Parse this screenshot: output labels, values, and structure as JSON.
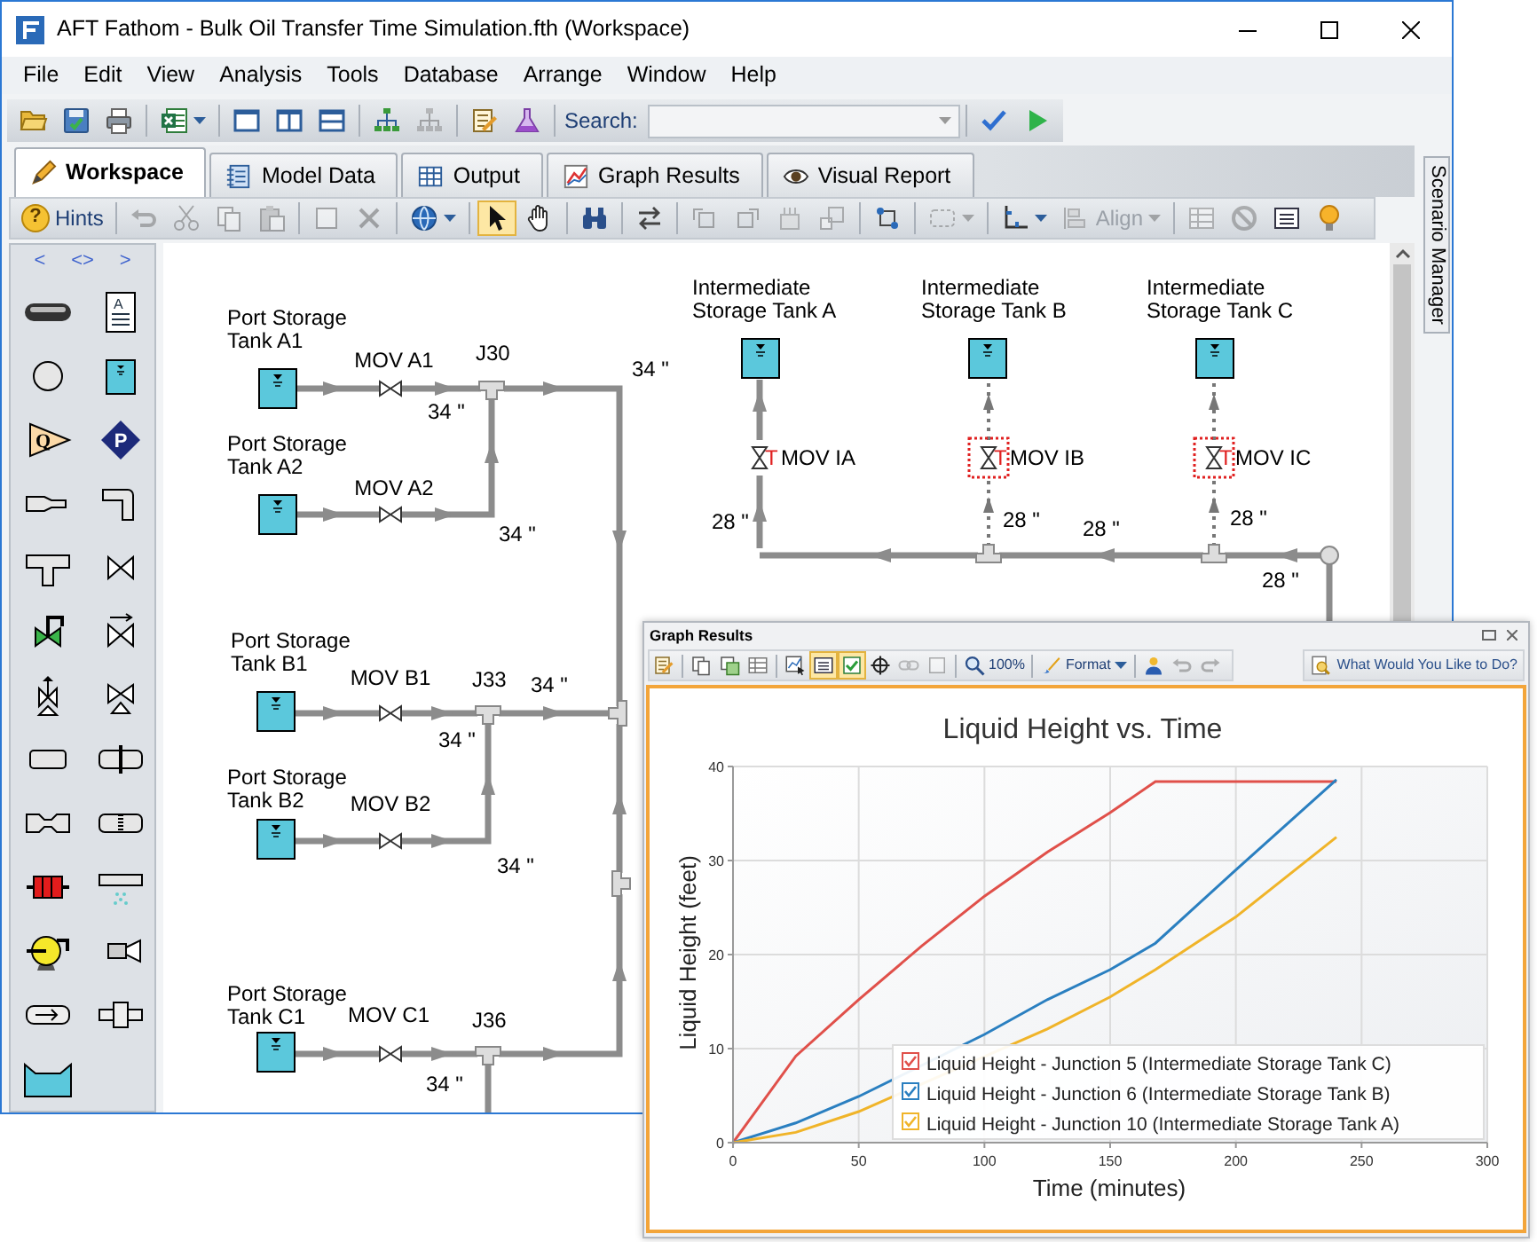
{
  "window": {
    "title": "AFT Fathom - Bulk Oil Transfer Time Simulation.fth (Workspace)"
  },
  "menu": [
    "File",
    "Edit",
    "View",
    "Analysis",
    "Tools",
    "Database",
    "Arrange",
    "Window",
    "Help"
  ],
  "toolbar": {
    "groups": [
      [
        {
          "kind": "open",
          "disabled": false,
          "selected": false,
          "dropdown": false
        },
        {
          "kind": "save",
          "disabled": false,
          "selected": false,
          "dropdown": false
        },
        {
          "kind": "print",
          "disabled": false,
          "selected": false,
          "dropdown": false
        }
      ],
      [
        {
          "kind": "export",
          "disabled": false,
          "selected": false,
          "dropdown": true
        }
      ],
      [
        {
          "kind": "pane-single",
          "disabled": false,
          "selected": false,
          "dropdown": false
        },
        {
          "kind": "pane-columns",
          "disabled": false,
          "selected": false,
          "dropdown": false
        },
        {
          "kind": "pane-rows",
          "disabled": false,
          "selected": false,
          "dropdown": false
        }
      ],
      [
        {
          "kind": "tree",
          "disabled": false,
          "selected": false,
          "dropdown": false
        },
        {
          "kind": "tree",
          "disabled": true,
          "selected": false,
          "dropdown": false
        }
      ],
      [
        {
          "kind": "edit-list",
          "disabled": false,
          "selected": false,
          "dropdown": false
        },
        {
          "kind": "flask",
          "disabled": false,
          "selected": false,
          "dropdown": false
        }
      ]
    ],
    "search": {
      "label": "Search:"
    },
    "after_groups": [
      [
        {
          "kind": "check",
          "disabled": false,
          "selected": false,
          "dropdown": false
        },
        {
          "kind": "run",
          "disabled": false,
          "selected": false,
          "dropdown": false
        }
      ]
    ]
  },
  "tabs": [
    {
      "label": "Workspace",
      "kind": "pencil",
      "selected": true
    },
    {
      "label": "Model Data",
      "kind": "notebook",
      "selected": false
    },
    {
      "label": "Output",
      "kind": "table",
      "selected": false
    },
    {
      "label": "Graph Results",
      "kind": "chart",
      "selected": false
    },
    {
      "label": "Visual Report",
      "kind": "eye",
      "selected": false
    }
  ],
  "workspace_toolbar": {
    "groups": [
      [
        {
          "kind": "hints",
          "glyph": "?",
          "label": "Hints",
          "disabled": false,
          "selected": false,
          "dropdown": false
        }
      ],
      [
        {
          "kind": "undo",
          "disabled": true,
          "selected": false,
          "dropdown": false
        },
        {
          "kind": "cut",
          "disabled": true,
          "selected": false,
          "dropdown": false
        },
        {
          "kind": "copy",
          "disabled": true,
          "selected": false,
          "dropdown": false
        },
        {
          "kind": "paste",
          "disabled": true,
          "selected": false,
          "dropdown": false
        }
      ],
      [
        {
          "kind": "square",
          "disabled": true,
          "selected": false,
          "dropdown": false
        },
        {
          "kind": "delete",
          "disabled": true,
          "selected": false,
          "dropdown": false
        }
      ],
      [
        {
          "kind": "globe",
          "disabled": false,
          "selected": false,
          "dropdown": true
        }
      ],
      [
        {
          "kind": "pointer",
          "disabled": false,
          "selected": true,
          "dropdown": false
        },
        {
          "kind": "hand",
          "disabled": false,
          "selected": false,
          "dropdown": false
        }
      ],
      [
        {
          "kind": "binoculars",
          "disabled": false,
          "selected": false,
          "dropdown": false
        }
      ],
      [
        {
          "kind": "swap",
          "disabled": false,
          "selected": false,
          "dropdown": false
        }
      ],
      [
        {
          "kind": "rotate-left",
          "disabled": true,
          "selected": false,
          "dropdown": false
        },
        {
          "kind": "rotate-right",
          "disabled": true,
          "selected": false,
          "dropdown": false
        },
        {
          "kind": "stack",
          "disabled": true,
          "selected": false,
          "dropdown": false
        },
        {
          "kind": "resize",
          "disabled": true,
          "selected": false,
          "dropdown": false
        }
      ],
      [
        {
          "kind": "nodes",
          "disabled": false,
          "selected": false,
          "dropdown": false
        }
      ],
      [
        {
          "kind": "dashed-select",
          "disabled": true,
          "selected": false,
          "dropdown": true
        }
      ],
      [
        {
          "kind": "axes",
          "disabled": false,
          "selected": false,
          "dropdown": true
        },
        {
          "kind": "align",
          "label": "Align",
          "disabled": true,
          "selected": false,
          "dropdown": true
        }
      ],
      [
        {
          "kind": "grid",
          "disabled": true,
          "selected": false,
          "dropdown": false
        },
        {
          "kind": "no-entry",
          "disabled": true,
          "selected": false,
          "dropdown": false
        },
        {
          "kind": "list-panel",
          "disabled": false,
          "selected": false,
          "dropdown": false
        },
        {
          "kind": "bulb",
          "disabled": false,
          "selected": false,
          "dropdown": false
        }
      ]
    ]
  },
  "palette": {
    "nav": [
      "<",
      "<>",
      ">"
    ],
    "annotation_letter": "A",
    "flow_letter": "Q",
    "pressure_letter": "P"
  },
  "diagram": {
    "tanks": [
      {
        "label": "Port Storage\nTank A1"
      },
      {
        "label": "Port Storage\nTank A2"
      },
      {
        "label": "Port Storage\nTank B1"
      },
      {
        "label": "Port Storage\nTank B2"
      },
      {
        "label": "Port Storage\nTank C1"
      },
      {
        "label": "Intermediate\nStorage Tank A"
      },
      {
        "label": "Intermediate\nStorage Tank B"
      },
      {
        "label": "Intermediate\nStorage Tank C"
      }
    ],
    "valves": [
      {
        "label": "MOV A1",
        "highlighted": false
      },
      {
        "label": "MOV A2",
        "highlighted": false
      },
      {
        "label": "MOV B1",
        "highlighted": false
      },
      {
        "label": "MOV B2",
        "highlighted": false
      },
      {
        "label": "MOV C1",
        "highlighted": false
      },
      {
        "label": "MOV IA",
        "flag": "T",
        "highlighted": false
      },
      {
        "label": "MOV IB",
        "flag": "T",
        "highlighted": true
      },
      {
        "label": "MOV IC",
        "flag": "T",
        "highlighted": true
      }
    ],
    "junctions": [
      {
        "label": "J30"
      },
      {
        "label": "J33"
      },
      {
        "label": "J36"
      }
    ],
    "pipes": [
      {
        "inactive": false
      },
      {
        "label": "34 \"",
        "inactive": false
      },
      {
        "label": "34 \"",
        "inactive": false
      },
      {
        "inactive": false
      },
      {
        "label": "34 \"",
        "inactive": false
      },
      {
        "inactive": false
      },
      {
        "label": "28 \"",
        "inactive": false
      },
      {
        "inactive": true
      },
      {
        "label": "28 \"",
        "inactive": true
      },
      {
        "inactive": true
      },
      {
        "label": "28 \"",
        "inactive": true
      },
      {
        "inactive": false
      },
      {
        "label": "28 \"",
        "inactive": false
      },
      {
        "label": "28 \"",
        "inactive": false
      },
      {
        "inactive": false
      },
      {
        "inactive": false
      },
      {
        "label": "34 \"",
        "inactive": false
      },
      {
        "label": "34 \"",
        "inactive": false
      },
      {
        "inactive": false
      },
      {
        "label": "34 \"",
        "inactive": false
      },
      {
        "inactive": false
      },
      {
        "inactive": false
      },
      {
        "label": "34 \"",
        "inactive": false
      },
      {
        "inactive": false
      },
      {
        "inactive": false
      }
    ]
  },
  "side_tab": "Scenario Manager",
  "graph_window": {
    "title": "Graph Results",
    "toolbar": {
      "groups": [
        [
          {
            "kind": "edit-list",
            "disabled": false,
            "selected": false,
            "dropdown": false
          }
        ],
        [
          {
            "kind": "copy",
            "disabled": false,
            "selected": false,
            "dropdown": false
          },
          {
            "kind": "copy-image",
            "disabled": false,
            "selected": false,
            "dropdown": false
          },
          {
            "kind": "grid",
            "disabled": false,
            "selected": false,
            "dropdown": false
          }
        ],
        [
          {
            "kind": "select-data",
            "disabled": false,
            "selected": false,
            "dropdown": false
          },
          {
            "kind": "list-panel",
            "disabled": false,
            "selected": true,
            "dropdown": false
          },
          {
            "kind": "checkbox",
            "disabled": false,
            "selected": true,
            "dropdown": false
          },
          {
            "kind": "crosshair",
            "disabled": false,
            "selected": false,
            "dropdown": false
          },
          {
            "kind": "link",
            "disabled": true,
            "selected": false,
            "dropdown": false
          },
          {
            "kind": "square",
            "disabled": true,
            "selected": false,
            "dropdown": false
          }
        ],
        [
          {
            "kind": "zoom",
            "label": "100%",
            "disabled": false,
            "selected": false,
            "dropdown": false
          }
        ],
        [
          {
            "kind": "brush",
            "label": "Format",
            "disabled": false,
            "selected": false,
            "dropdown": true
          }
        ],
        [
          {
            "kind": "person",
            "disabled": false,
            "selected": false,
            "dropdown": false
          },
          {
            "kind": "undo",
            "disabled": true,
            "selected": false,
            "dropdown": false
          },
          {
            "kind": "redo",
            "disabled": true,
            "selected": false,
            "dropdown": false
          }
        ]
      ]
    },
    "help": "What Would You Like to Do?",
    "legend": [
      {
        "checked": true
      },
      {
        "checked": true
      },
      {
        "checked": true
      }
    ],
    "chart_data": {
      "type": "line",
      "title": "Liquid Height vs. Time",
      "xlabel": "Time (minutes)",
      "ylabel": "Liquid Height (feet)",
      "x": [
        0,
        25,
        50,
        75,
        100,
        125,
        150,
        168,
        200,
        240
      ],
      "series": [
        {
          "name": "Liquid Height - Junction 5 (Intermediate Storage Tank C)",
          "color": "#e0504a",
          "values": [
            0,
            9.2,
            15.2,
            20.9,
            26.2,
            30.9,
            35.1,
            38.4,
            38.4,
            38.4
          ]
        },
        {
          "name": "Liquid Height - Junction 6 (Intermediate Storage Tank B)",
          "color": "#2a7fc0",
          "values": [
            0,
            2.1,
            4.9,
            null,
            11.5,
            15.2,
            18.4,
            21.2,
            29,
            38.6
          ]
        },
        {
          "name": "Liquid Height - Junction 10 (Intermediate Storage Tank A)",
          "color": "#f0b429",
          "values": [
            0,
            1.1,
            3.3,
            null,
            null,
            12.1,
            15.5,
            18.4,
            24,
            32.5
          ]
        }
      ],
      "xlim": [
        0,
        300
      ],
      "ylim": [
        0,
        40
      ],
      "grid": true,
      "legend": true,
      "xticks": [
        0,
        50,
        100,
        150,
        200,
        250,
        300
      ],
      "yticks": [
        0,
        10,
        20,
        30,
        40
      ]
    }
  }
}
